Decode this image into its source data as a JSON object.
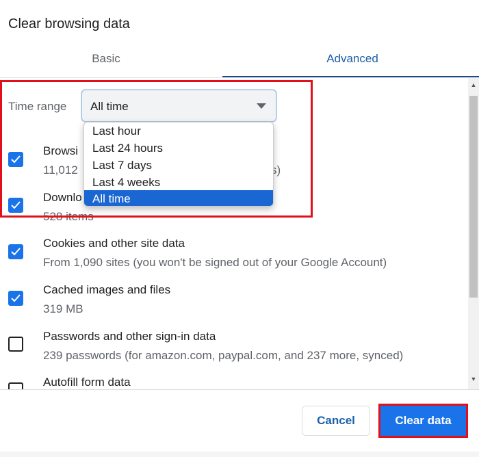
{
  "dialog": {
    "title": "Clear browsing data"
  },
  "tabs": [
    {
      "label": "Basic",
      "active": false
    },
    {
      "label": "Advanced",
      "active": true
    }
  ],
  "time_range": {
    "label": "Time range",
    "value": "All time",
    "options": [
      "Last hour",
      "Last 24 hours",
      "Last 7 days",
      "Last 4 weeks",
      "All time"
    ],
    "selected_index": 4
  },
  "items": [
    {
      "title": "Browsi",
      "desc": "11,012",
      "desc_tail": "s)",
      "checked": true
    },
    {
      "title": "Downlo",
      "desc": "528 items",
      "checked": true
    },
    {
      "title": "Cookies and other site data",
      "desc": "From 1,090 sites (you won't be signed out of your Google Account)",
      "checked": true
    },
    {
      "title": "Cached images and files",
      "desc": "319 MB",
      "checked": true
    },
    {
      "title": "Passwords and other sign-in data",
      "desc": "239 passwords (for amazon.com, paypal.com, and 237 more, synced)",
      "checked": false
    },
    {
      "title": "Autofill form data",
      "checked": false
    }
  ],
  "buttons": {
    "cancel": "Cancel",
    "clear": "Clear data"
  },
  "colors": {
    "accent": "#1a73e8",
    "highlight": "#e0101c"
  }
}
